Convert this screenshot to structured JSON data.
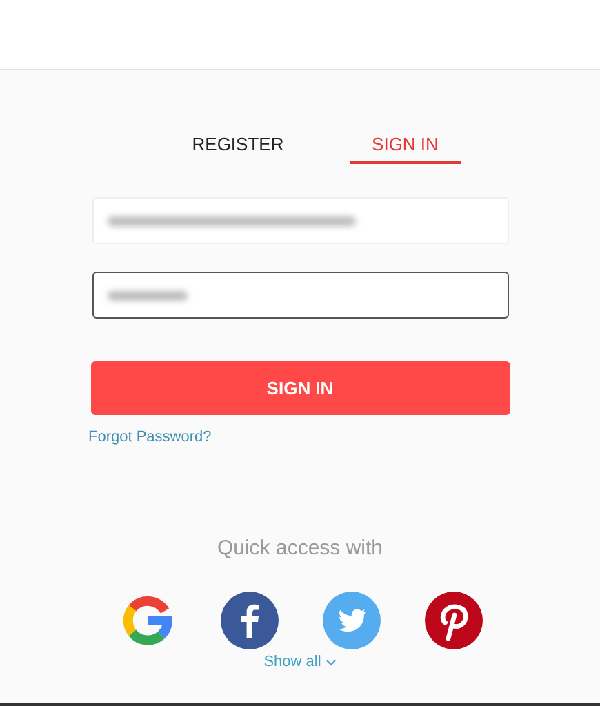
{
  "tabs": [
    {
      "label": "REGISTER",
      "selected": false
    },
    {
      "label": "SIGN IN",
      "selected": true
    }
  ],
  "fields": [
    {
      "kind": "email",
      "focused": false
    },
    {
      "kind": "password",
      "focused": true
    }
  ],
  "submit": "SIGN IN",
  "forgot_link": "Forgot Password?",
  "quick_access": {
    "title": "Quick access with",
    "providers": [
      {
        "kind": "google"
      },
      {
        "kind": "facebook"
      },
      {
        "kind": "twitter"
      },
      {
        "kind": "pinterest"
      }
    ],
    "show_all": "Show all"
  }
}
